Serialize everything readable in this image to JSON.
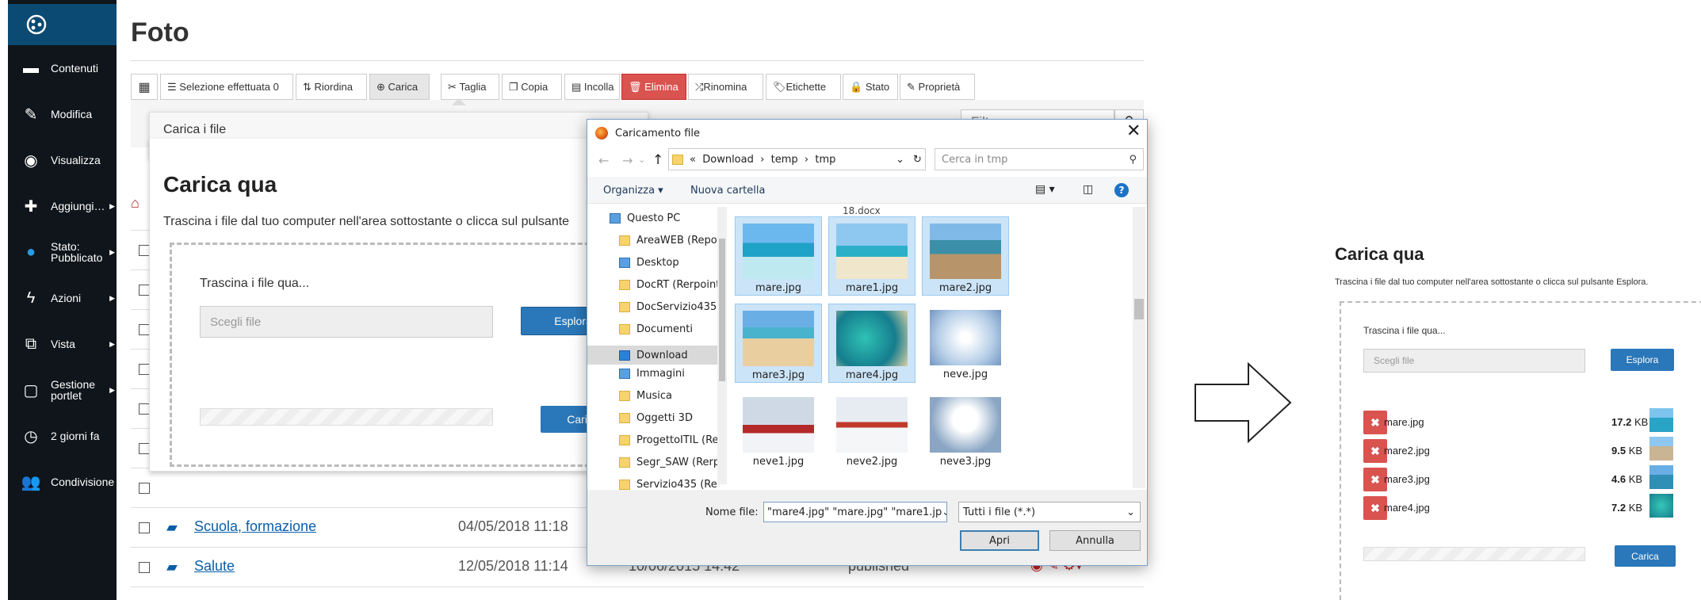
{
  "sidebar": {
    "items": [
      {
        "label": "Contenuti",
        "icon": "folder-icon",
        "caret": false
      },
      {
        "label": "Modifica",
        "icon": "pencil-icon",
        "caret": false
      },
      {
        "label": "Visualizza",
        "icon": "eye-icon",
        "caret": false
      },
      {
        "label": "Aggiungi…",
        "icon": "plus-icon",
        "caret": true
      },
      {
        "label": "Stato:\nPubblicato",
        "icon": "globe-icon",
        "caret": true
      },
      {
        "label": "Azioni",
        "icon": "bolt-icon",
        "caret": true
      },
      {
        "label": "Vista",
        "icon": "view-icon",
        "caret": true
      },
      {
        "label": "Gestione\nportlet",
        "icon": "portlet-icon",
        "caret": true
      },
      {
        "label": "2 giorni fa",
        "icon": "clock-icon",
        "caret": false
      },
      {
        "label": "Condivisione",
        "icon": "users-icon",
        "caret": false
      }
    ]
  },
  "page": {
    "title": "Foto"
  },
  "toolbar": {
    "grid": "▦",
    "selection": "Selezione effettuata",
    "selection_count": "0",
    "reorder": "Riordina",
    "upload": "Carica",
    "cut": "Taglia",
    "copy": "Copia",
    "paste": "Incolla",
    "delete": "Elimina",
    "rename": "Rinomina",
    "tags": "Etichette",
    "state": "Stato",
    "properties": "Proprietà",
    "filter_placeholder": "Filtro"
  },
  "rows": [
    {
      "name": "Scuola, formazione",
      "created": "04/05/2018 11:18"
    },
    {
      "name": "Salute",
      "created": "12/05/2018 11:14",
      "modified": "10/06/2015 14:42",
      "state": "published"
    }
  ],
  "upload_panel": {
    "tab": "Carica i file",
    "heading": "Carica qua",
    "instructions": "Trascina i file dal tuo computer nell'area sottostante o clicca sul pulsante",
    "drop": "Trascina i file qua...",
    "choose": "Scegli file",
    "browse": "Esplora",
    "upload": "Carica"
  },
  "dialog": {
    "title": "Caricamento file",
    "path": [
      "«",
      "Download",
      "temp",
      "tmp"
    ],
    "search_placeholder": "Cerca in tmp",
    "organize": "Organizza ▾",
    "new_folder": "Nuova cartella",
    "top_cut_file": "18.docx",
    "tree": [
      "Questo PC",
      "AreaWEB (Repo",
      "Desktop",
      "DocRT (Rerpoint",
      "DocServizio435 (",
      "Documenti",
      "Download",
      "Immagini",
      "Musica",
      "Oggetti 3D",
      "ProgettoITIL (Re",
      "Segr_SAW (Rerpo",
      "Servizio435 (Rerr"
    ],
    "files": [
      {
        "name": "mare.jpg",
        "sel": true
      },
      {
        "name": "mare1.jpg",
        "sel": true
      },
      {
        "name": "mare2.jpg",
        "sel": true
      },
      {
        "name": "mare3.jpg",
        "sel": true
      },
      {
        "name": "mare4.jpg",
        "sel": true
      },
      {
        "name": "neve.jpg",
        "sel": false
      },
      {
        "name": "neve1.jpg",
        "sel": false
      },
      {
        "name": "neve2.jpg",
        "sel": false
      },
      {
        "name": "neve3.jpg",
        "sel": false
      }
    ],
    "filename_label": "Nome file:",
    "filename_value": "\"mare4.jpg\" \"mare.jpg\" \"mare1.jp",
    "filter": "Tutti i file (*.*)",
    "open": "Apri",
    "cancel": "Annulla"
  },
  "result": {
    "heading": "Carica qua",
    "instructions": "Trascina i file dal tuo computer nell'area sottostante o clicca sul pulsante Esplora.",
    "drop": "Trascina i file qua...",
    "choose": "Scegli file",
    "browse": "Esplora",
    "upload": "Carica",
    "files": [
      {
        "name": "mare.jpg",
        "size": "17.2",
        "unit": "KB"
      },
      {
        "name": "mare2.jpg",
        "size": "9.5",
        "unit": "KB"
      },
      {
        "name": "mare3.jpg",
        "size": "4.6",
        "unit": "KB"
      },
      {
        "name": "mare4.jpg",
        "size": "7.2",
        "unit": "KB"
      }
    ]
  },
  "colors": {
    "sidebar": "#10151b",
    "accent": "#2a77b9",
    "danger": "#d9534f",
    "link": "#0a5ea8"
  }
}
